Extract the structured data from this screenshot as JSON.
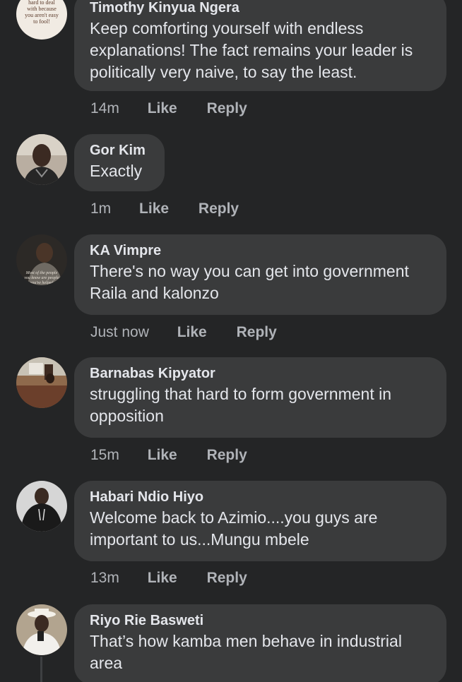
{
  "comments": [
    {
      "author": "Timothy Kinyua Ngera",
      "text": "Keep comforting yourself with endless explanations! The fact remains your leader is politically very naive, to say the least.",
      "time": "14m",
      "like": "Like",
      "reply": "Reply",
      "avatar_text": "hard to deal with because you aren't easy to fool!",
      "avatar": "quote-image-avatar"
    },
    {
      "author": "Gor Kim",
      "text": "Exactly",
      "time": "1m",
      "like": "Like",
      "reply": "Reply",
      "avatar": "user-photo-avatar"
    },
    {
      "author": "KA Vimpre",
      "text": "There's no way you can get into government Raila and kalonzo",
      "time": "Just now",
      "like": "Like",
      "reply": "Reply",
      "avatar_text": "Most of the people you know are people you've helped",
      "avatar": "quote-photo-avatar"
    },
    {
      "author": "Barnabas Kipyator",
      "text": "struggling that hard to form government in opposition",
      "time": "15m",
      "like": "Like",
      "reply": "Reply",
      "avatar": "office-photo-avatar"
    },
    {
      "author": "Habari Ndio Hiyo",
      "text": "Welcome back to Azimio....you guys are important to us...Mungu mbele",
      "time": "13m",
      "like": "Like",
      "reply": "Reply",
      "avatar": "hoodie-photo-avatar"
    },
    {
      "author": "Riyo Rie Basweti",
      "text": "That’s how kamba men behave in industrial area",
      "time": "",
      "like": "",
      "reply": "",
      "avatar": "hat-photo-avatar"
    }
  ],
  "colors": {
    "background": "#242526",
    "bubble": "#3a3b3c",
    "primary_text": "#e4e6eb",
    "secondary_text": "#b0b3b8"
  }
}
